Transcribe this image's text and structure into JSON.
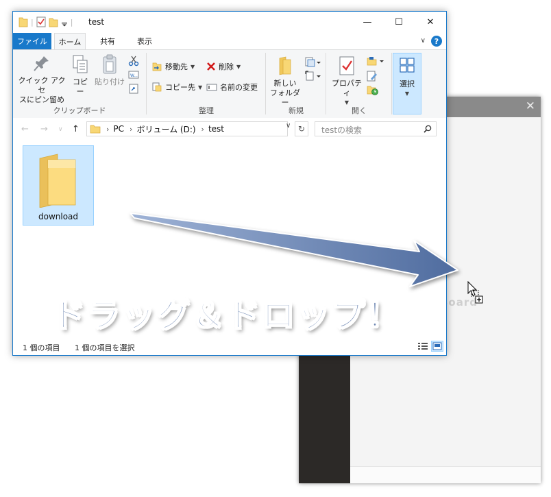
{
  "background_app": {
    "close_glyph": "✕",
    "logo_text": "Board"
  },
  "explorer": {
    "title": "test",
    "window_controls": {
      "minimize": "—",
      "maximize": "☐",
      "close": "✕"
    },
    "tabs": [
      {
        "label": "ファイル"
      },
      {
        "label": "ホーム"
      },
      {
        "label": "共有"
      },
      {
        "label": "表示"
      }
    ],
    "ribbon": {
      "clipboard": {
        "label": "クリップボード",
        "pin_quick_access": [
          "クイック アクセ",
          "スにピン留め"
        ],
        "copy": "コピー",
        "paste": "貼り付け"
      },
      "organize": {
        "label": "整理",
        "move_to": "移動先",
        "copy_to": "コピー先",
        "delete": "削除",
        "rename": "名前の変更"
      },
      "new": {
        "label": "新規",
        "new_folder": [
          "新しい",
          "フォルダー"
        ]
      },
      "open": {
        "label": "開く",
        "properties": "プロパティ"
      },
      "select": {
        "label": "選択"
      }
    },
    "address": {
      "crumbs": [
        "PC",
        "ボリューム (D:)",
        "test"
      ],
      "search_placeholder": "testの検索"
    },
    "items": [
      {
        "name": "download"
      }
    ],
    "status": {
      "count": "1 個の項目",
      "selected": "1 個の項目を選択"
    }
  },
  "overlay": {
    "caption": "ドラッグ＆ドロップ！"
  },
  "colors": {
    "accent": "#1979ca",
    "selection": "#cce8ff",
    "arrow": "#5b77a6",
    "folder": "#f8d775"
  }
}
